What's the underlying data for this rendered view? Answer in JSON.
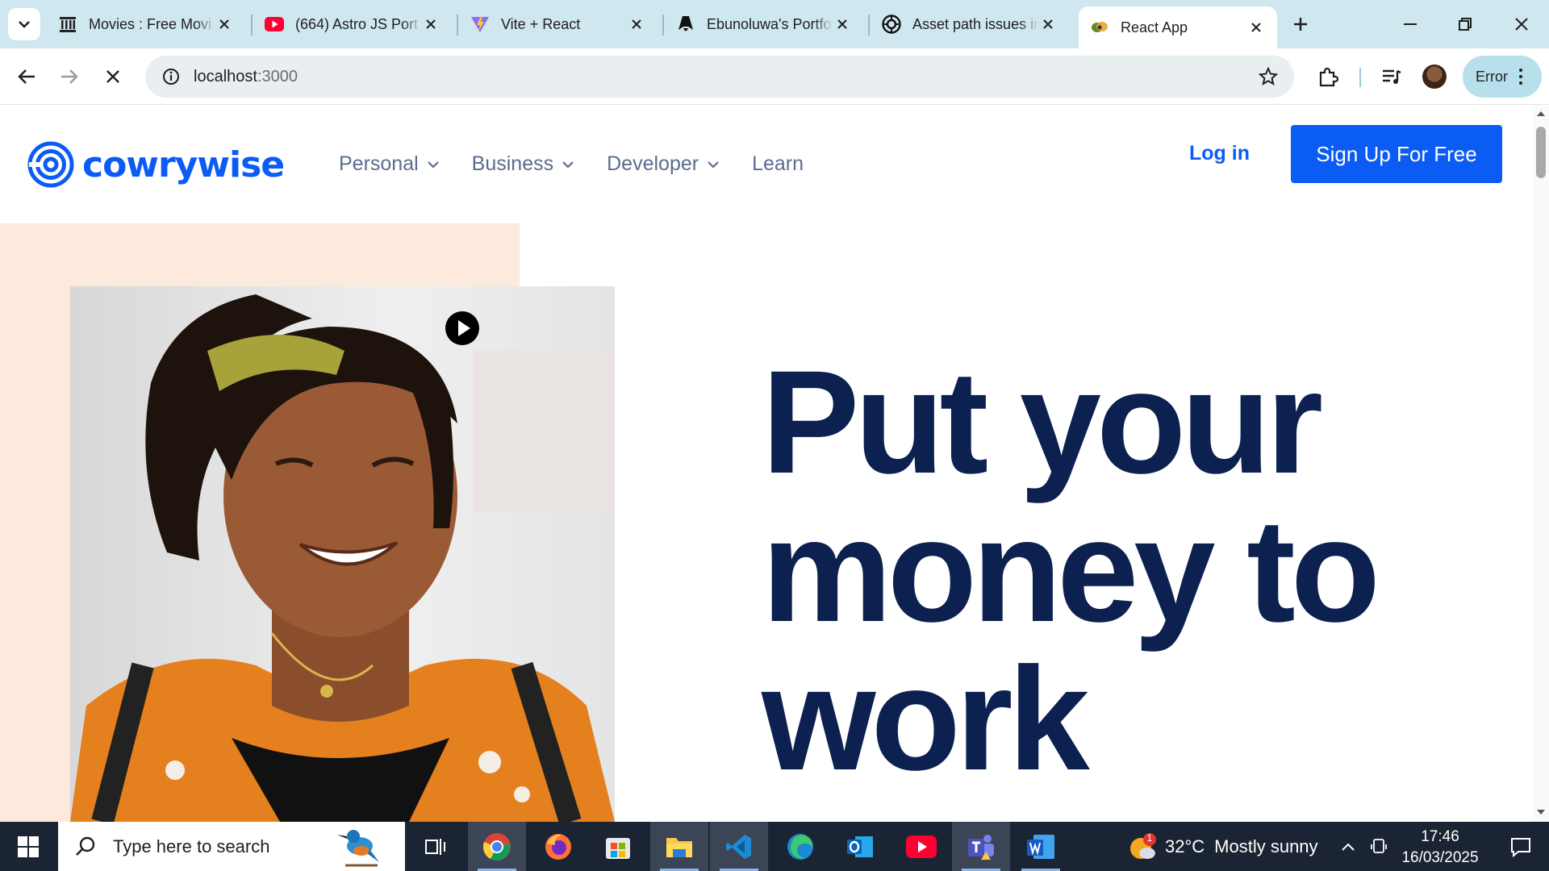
{
  "browser": {
    "tabs": [
      {
        "title": "Movies : Free Movi",
        "icon": "archive-icon"
      },
      {
        "title": "(664) Astro JS Port",
        "icon": "youtube-icon"
      },
      {
        "title": "Vite + React",
        "icon": "vite-icon"
      },
      {
        "title": "Ebunoluwa's Portfo",
        "icon": "astro-icon"
      },
      {
        "title": "Asset path issues in",
        "icon": "openai-icon"
      },
      {
        "title": "React App",
        "icon": "react-app-icon",
        "active": true
      }
    ],
    "url_host": "localhost",
    "url_port": ":3000",
    "profile_label": "Error"
  },
  "site": {
    "brand": "cowrywise",
    "nav": [
      {
        "label": "Personal",
        "has_dropdown": true
      },
      {
        "label": "Business",
        "has_dropdown": true
      },
      {
        "label": "Developer",
        "has_dropdown": true
      },
      {
        "label": "Learn",
        "has_dropdown": false
      }
    ],
    "login_label": "Log in",
    "signup_label": "Sign Up For Free",
    "hero": {
      "lines": [
        "Put your",
        "money to",
        "work"
      ]
    },
    "colors": {
      "brand_blue": "#0a5cf5",
      "hero_navy": "#0c2150",
      "peach": "#fdeadd"
    }
  },
  "taskbar": {
    "search_placeholder": "Type here to search",
    "weather_temp": "32°C",
    "weather_desc": "Mostly sunny",
    "weather_badge": "1",
    "time": "17:46",
    "date": "16/03/2025",
    "apps": [
      "task-view-icon",
      "chrome-icon",
      "firefox-icon",
      "microsoft-store-icon",
      "file-explorer-icon",
      "vscode-icon",
      "edge-icon",
      "outlook-icon",
      "youtube-icon",
      "teams-icon",
      "word-icon"
    ]
  }
}
